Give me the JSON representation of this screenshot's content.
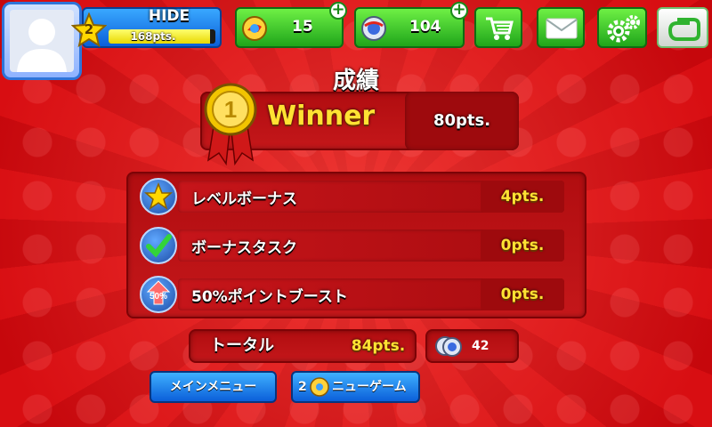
{
  "player": {
    "name": "HIDE",
    "level": "2",
    "points_label": "168pts.",
    "progress_fraction": 0.95
  },
  "currencies": [
    {
      "name": "coins",
      "value": "15"
    },
    {
      "name": "tokens",
      "value": "104"
    }
  ],
  "top_buttons": [
    "shop-cart-icon",
    "mail-icon",
    "settings-gear-icon",
    "gameloft-logo-icon"
  ],
  "screen": {
    "title": "成績",
    "result_label": "Winner",
    "result_pts": "80pts."
  },
  "bonuses": [
    {
      "label": "レベルボーナス",
      "pts": "4pts.",
      "icon": "star-icon"
    },
    {
      "label": "ボーナスタスク",
      "pts": "0pts.",
      "icon": "check-icon"
    },
    {
      "label": "50%ポイントブースト",
      "pts": "0pts.",
      "icon": "boost-50-icon",
      "icon_text": "50%"
    }
  ],
  "total": {
    "label": "トータル",
    "pts": "84pts."
  },
  "token_reward": {
    "value": "42"
  },
  "buttons": {
    "main_menu": "メインメニュー",
    "new_game_cost": "2",
    "new_game": "ニューゲーム"
  },
  "colors": {
    "background": "#d80e12",
    "green_button": "#1fa51a",
    "blue_button": "#0b5fd9",
    "points_yellow": "#ffe233"
  }
}
